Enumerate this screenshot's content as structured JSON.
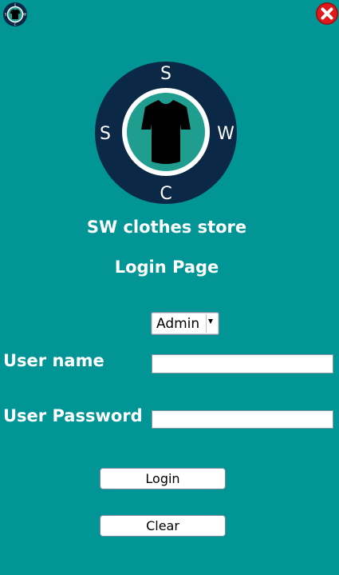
{
  "header": {
    "app_icon": "shirt-logo-icon",
    "close_icon": "close-icon",
    "close_color": "#e0191b"
  },
  "logo": {
    "letters": {
      "top": "S",
      "left": "S",
      "right": "W",
      "bottom": "C"
    },
    "icon": "shirt-icon",
    "colors": {
      "outer": "#0b2846",
      "ring": "#ffffff",
      "inner": "#1f9e8f",
      "shirt": "#000000"
    }
  },
  "store_title": "SW clothes store",
  "page_title": "Login Page",
  "role_select": {
    "selected": "Admin"
  },
  "form": {
    "username_label": "User name",
    "username_value": "",
    "password_label": "User Password",
    "password_value": ""
  },
  "buttons": {
    "login": "Login",
    "clear": "Clear"
  },
  "theme": {
    "background": "#029596"
  }
}
